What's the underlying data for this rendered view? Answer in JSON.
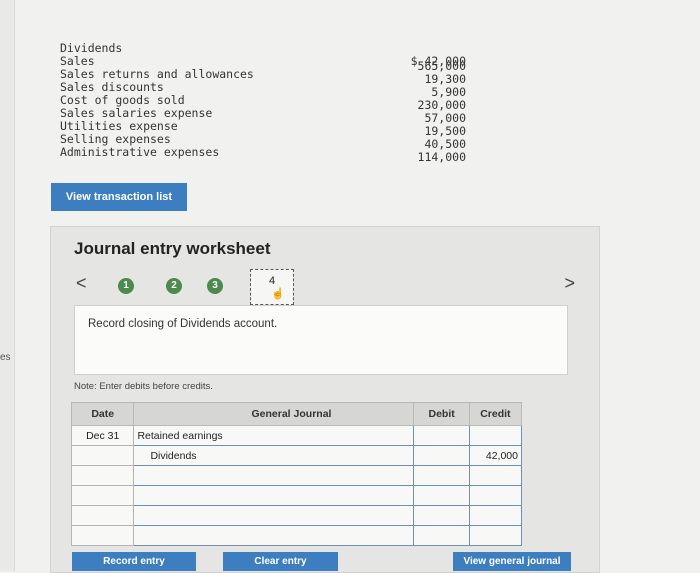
{
  "edge_label": "es",
  "accounts": [
    {
      "name": "Dividends",
      "amount": "$ 42,000"
    },
    {
      "name": "Sales",
      "amount": "565,000"
    },
    {
      "name": "Sales returns and allowances",
      "amount": "19,300"
    },
    {
      "name": "Sales discounts",
      "amount": "5,900"
    },
    {
      "name": "Cost of goods sold",
      "amount": "230,000"
    },
    {
      "name": "Sales salaries expense",
      "amount": "57,000"
    },
    {
      "name": "Utilities expense",
      "amount": "19,500"
    },
    {
      "name": "Selling expenses",
      "amount": "40,500"
    },
    {
      "name": "Administrative expenses",
      "amount": "114,000"
    }
  ],
  "view_transaction_label": "View transaction list",
  "worksheet": {
    "title": "Journal entry worksheet",
    "prev_symbol": "<",
    "next_symbol": ">",
    "steps": [
      "1",
      "2",
      "3",
      "4"
    ],
    "current_step": "4",
    "instruction": "Record closing of Dividends account.",
    "note": "Note: Enter debits before credits."
  },
  "table": {
    "headers": {
      "date": "Date",
      "journal": "General Journal",
      "debit": "Debit",
      "credit": "Credit"
    },
    "rows": [
      {
        "date": "Dec 31",
        "account": "Retained earnings",
        "debit": "",
        "credit": ""
      },
      {
        "date": "",
        "account": "Dividends",
        "debit": "",
        "credit": "42,000"
      }
    ]
  },
  "buttons": {
    "record": "Record entry",
    "clear": "Clear entry",
    "view_journal": "View general journal"
  },
  "colors": {
    "accent": "#3d7ec1",
    "step_done": "#4d8a4d"
  }
}
